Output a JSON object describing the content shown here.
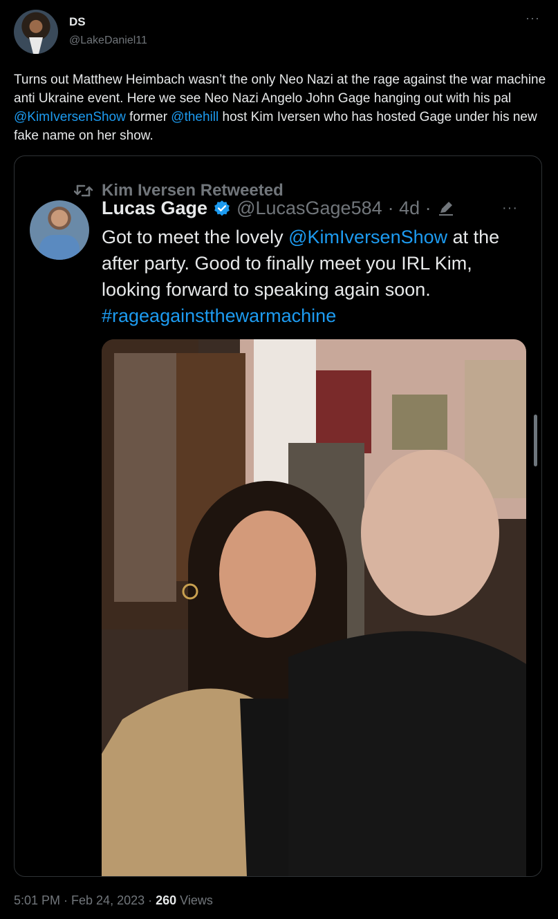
{
  "tweet": {
    "author_name": "DS",
    "author_handle": "@LakeDaniel11",
    "more": "···",
    "text_parts": {
      "p1": "Turns out Matthew Heimbach wasn’t the only Neo Nazi at the rage against the war machine anti Ukraine event. Here we see Neo Nazi Angelo John Gage hanging out with his pal ",
      "m1": "@KimIversenShow",
      "p2": " former ",
      "m2": "@thehill",
      "p3": " host Kim Iversen who has hosted Gage under his new fake name on her show."
    },
    "time": "5:01 PM · Feb 24, 2023 · ",
    "views_count": "260",
    "views_label": " Views"
  },
  "quote": {
    "retweeted_by": "Kim Iversen Retweeted",
    "author_name": "Lucas Gage",
    "author_handle": "@LucasGage584",
    "age": "· 4d ·",
    "more": "···",
    "text_parts": {
      "p1": "Got to meet the lovely ",
      "m1": "@KimIversenShow",
      "p2": " at the after party. Good to finally meet you IRL Kim, looking forward to speaking again soon. ",
      "hashtag": "#rageagainstthewarmachine"
    }
  },
  "colors": {
    "accent": "#1d9bf0",
    "muted": "#71767b",
    "text": "#e7e9ea",
    "border": "#2f3336"
  },
  "icons": [
    "retweet-icon",
    "verified-badge-icon",
    "edit-pencil-icon",
    "more-icon"
  ]
}
